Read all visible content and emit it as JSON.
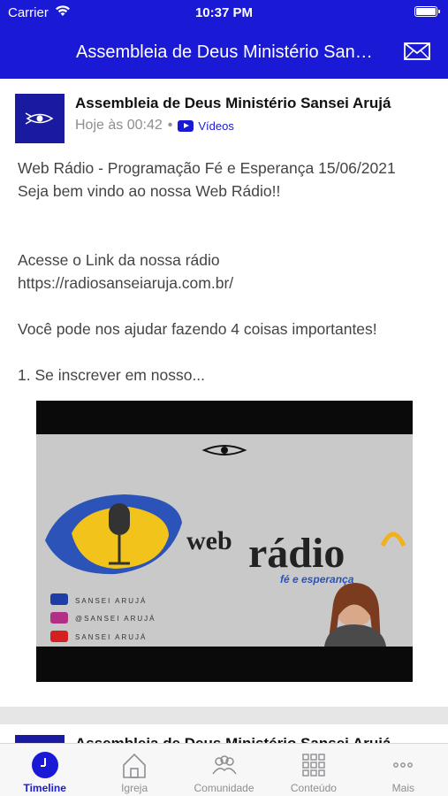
{
  "status_bar": {
    "carrier": "Carrier",
    "time": "10:37 PM"
  },
  "nav": {
    "title": "Assembleia de Deus Ministério Sansei Arujá",
    "mail_icon": "envelope-icon"
  },
  "post": {
    "author": "Assembleia de Deus Ministério Sansei Arujá",
    "time": "Hoje às 00:42",
    "separator": "•",
    "category": "Vídeos",
    "lines": [
      "Web Rádio - Programação Fé e Esperança 15/06/2021",
      "Seja bem vindo ao nossa Web Rádio!!",
      "Acesse o Link da nossa rádio",
      "https://radiosanseiaruja.com.br/",
      "Você pode nos ajudar fazendo 4 coisas importantes!",
      "1. Se inscrever em nosso..."
    ],
    "thumbnail": {
      "title_small": "web",
      "title_large": "rádio",
      "subtitle": "fé e esperança",
      "social": [
        {
          "icon": "facebook-icon",
          "text": "SANSEI ARUJÁ"
        },
        {
          "icon": "instagram-icon",
          "text": "@SANSEI ARUJÁ"
        },
        {
          "icon": "youtube-icon",
          "text": "SANSEI ARUJÁ"
        }
      ]
    }
  },
  "next_post": {
    "author": "Assembleia de Deus Ministério Sansei Arujá"
  },
  "tabs": [
    {
      "label": "Timeline",
      "icon": "clock-icon",
      "active": true
    },
    {
      "label": "Igreja",
      "icon": "church-icon",
      "active": false
    },
    {
      "label": "Comunidade",
      "icon": "people-icon",
      "active": false
    },
    {
      "label": "Conteúdo",
      "icon": "grid-icon",
      "active": false
    },
    {
      "label": "Mais",
      "icon": "more-icon",
      "active": false
    }
  ],
  "colors": {
    "brand": "#1a1ad6",
    "inactive": "#8e8e93"
  }
}
